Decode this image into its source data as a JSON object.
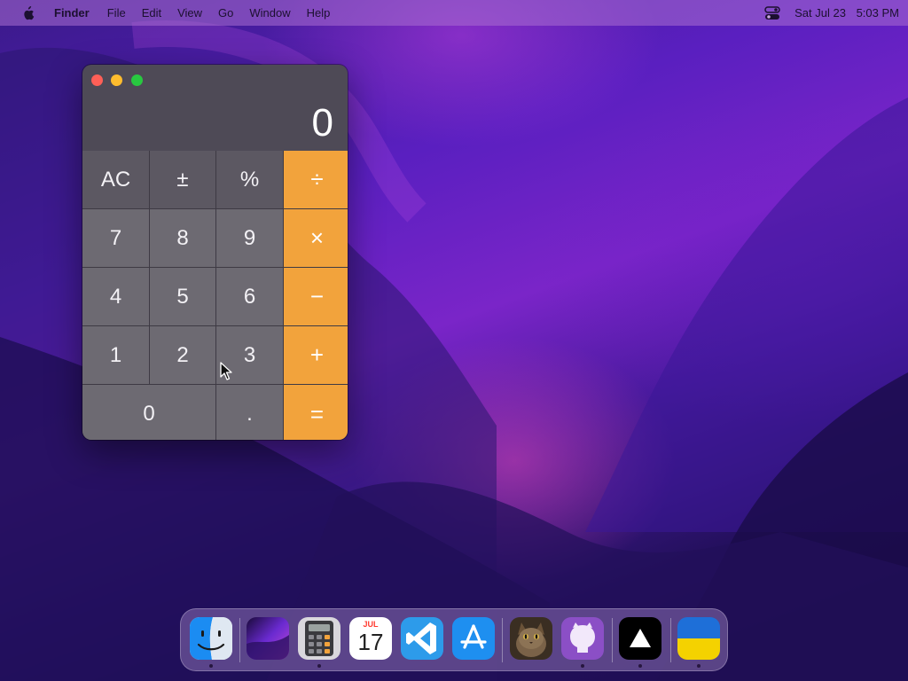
{
  "menubar": {
    "apple_icon": "apple-logo-icon",
    "app_name": "Finder",
    "items": [
      "File",
      "Edit",
      "View",
      "Go",
      "Window",
      "Help"
    ],
    "control_center_icon": "control-center-icon",
    "date": "Sat Jul 23",
    "time": "5:03 PM"
  },
  "calculator": {
    "display": "0",
    "keys": {
      "ac": "AC",
      "plus_minus": "±",
      "percent": "%",
      "divide": "÷",
      "seven": "7",
      "eight": "8",
      "nine": "9",
      "multiply": "×",
      "four": "4",
      "five": "5",
      "six": "6",
      "minus": "−",
      "one": "1",
      "two": "2",
      "three": "3",
      "plus": "+",
      "zero": "0",
      "decimal": ".",
      "equals": "="
    },
    "colors": {
      "operator": "#f2a33c",
      "number_key": "#6d6a72",
      "function_key": "#5c5862"
    }
  },
  "dock": {
    "apps": [
      {
        "name": "finder-icon",
        "running": true
      },
      {
        "name": "launchpad-icon",
        "running": false
      },
      {
        "name": "calculator-icon",
        "running": true
      },
      {
        "name": "calendar-icon",
        "running": false,
        "month": "JUL",
        "day": "17"
      },
      {
        "name": "vscode-icon",
        "running": false
      },
      {
        "name": "app-store-icon",
        "running": false
      },
      {
        "name": "cat-photo-icon",
        "running": false
      },
      {
        "name": "github-desktop-icon",
        "running": true
      },
      {
        "name": "vercel-icon",
        "running": true
      },
      {
        "name": "ukraine-flag-icon",
        "running": true
      }
    ]
  }
}
